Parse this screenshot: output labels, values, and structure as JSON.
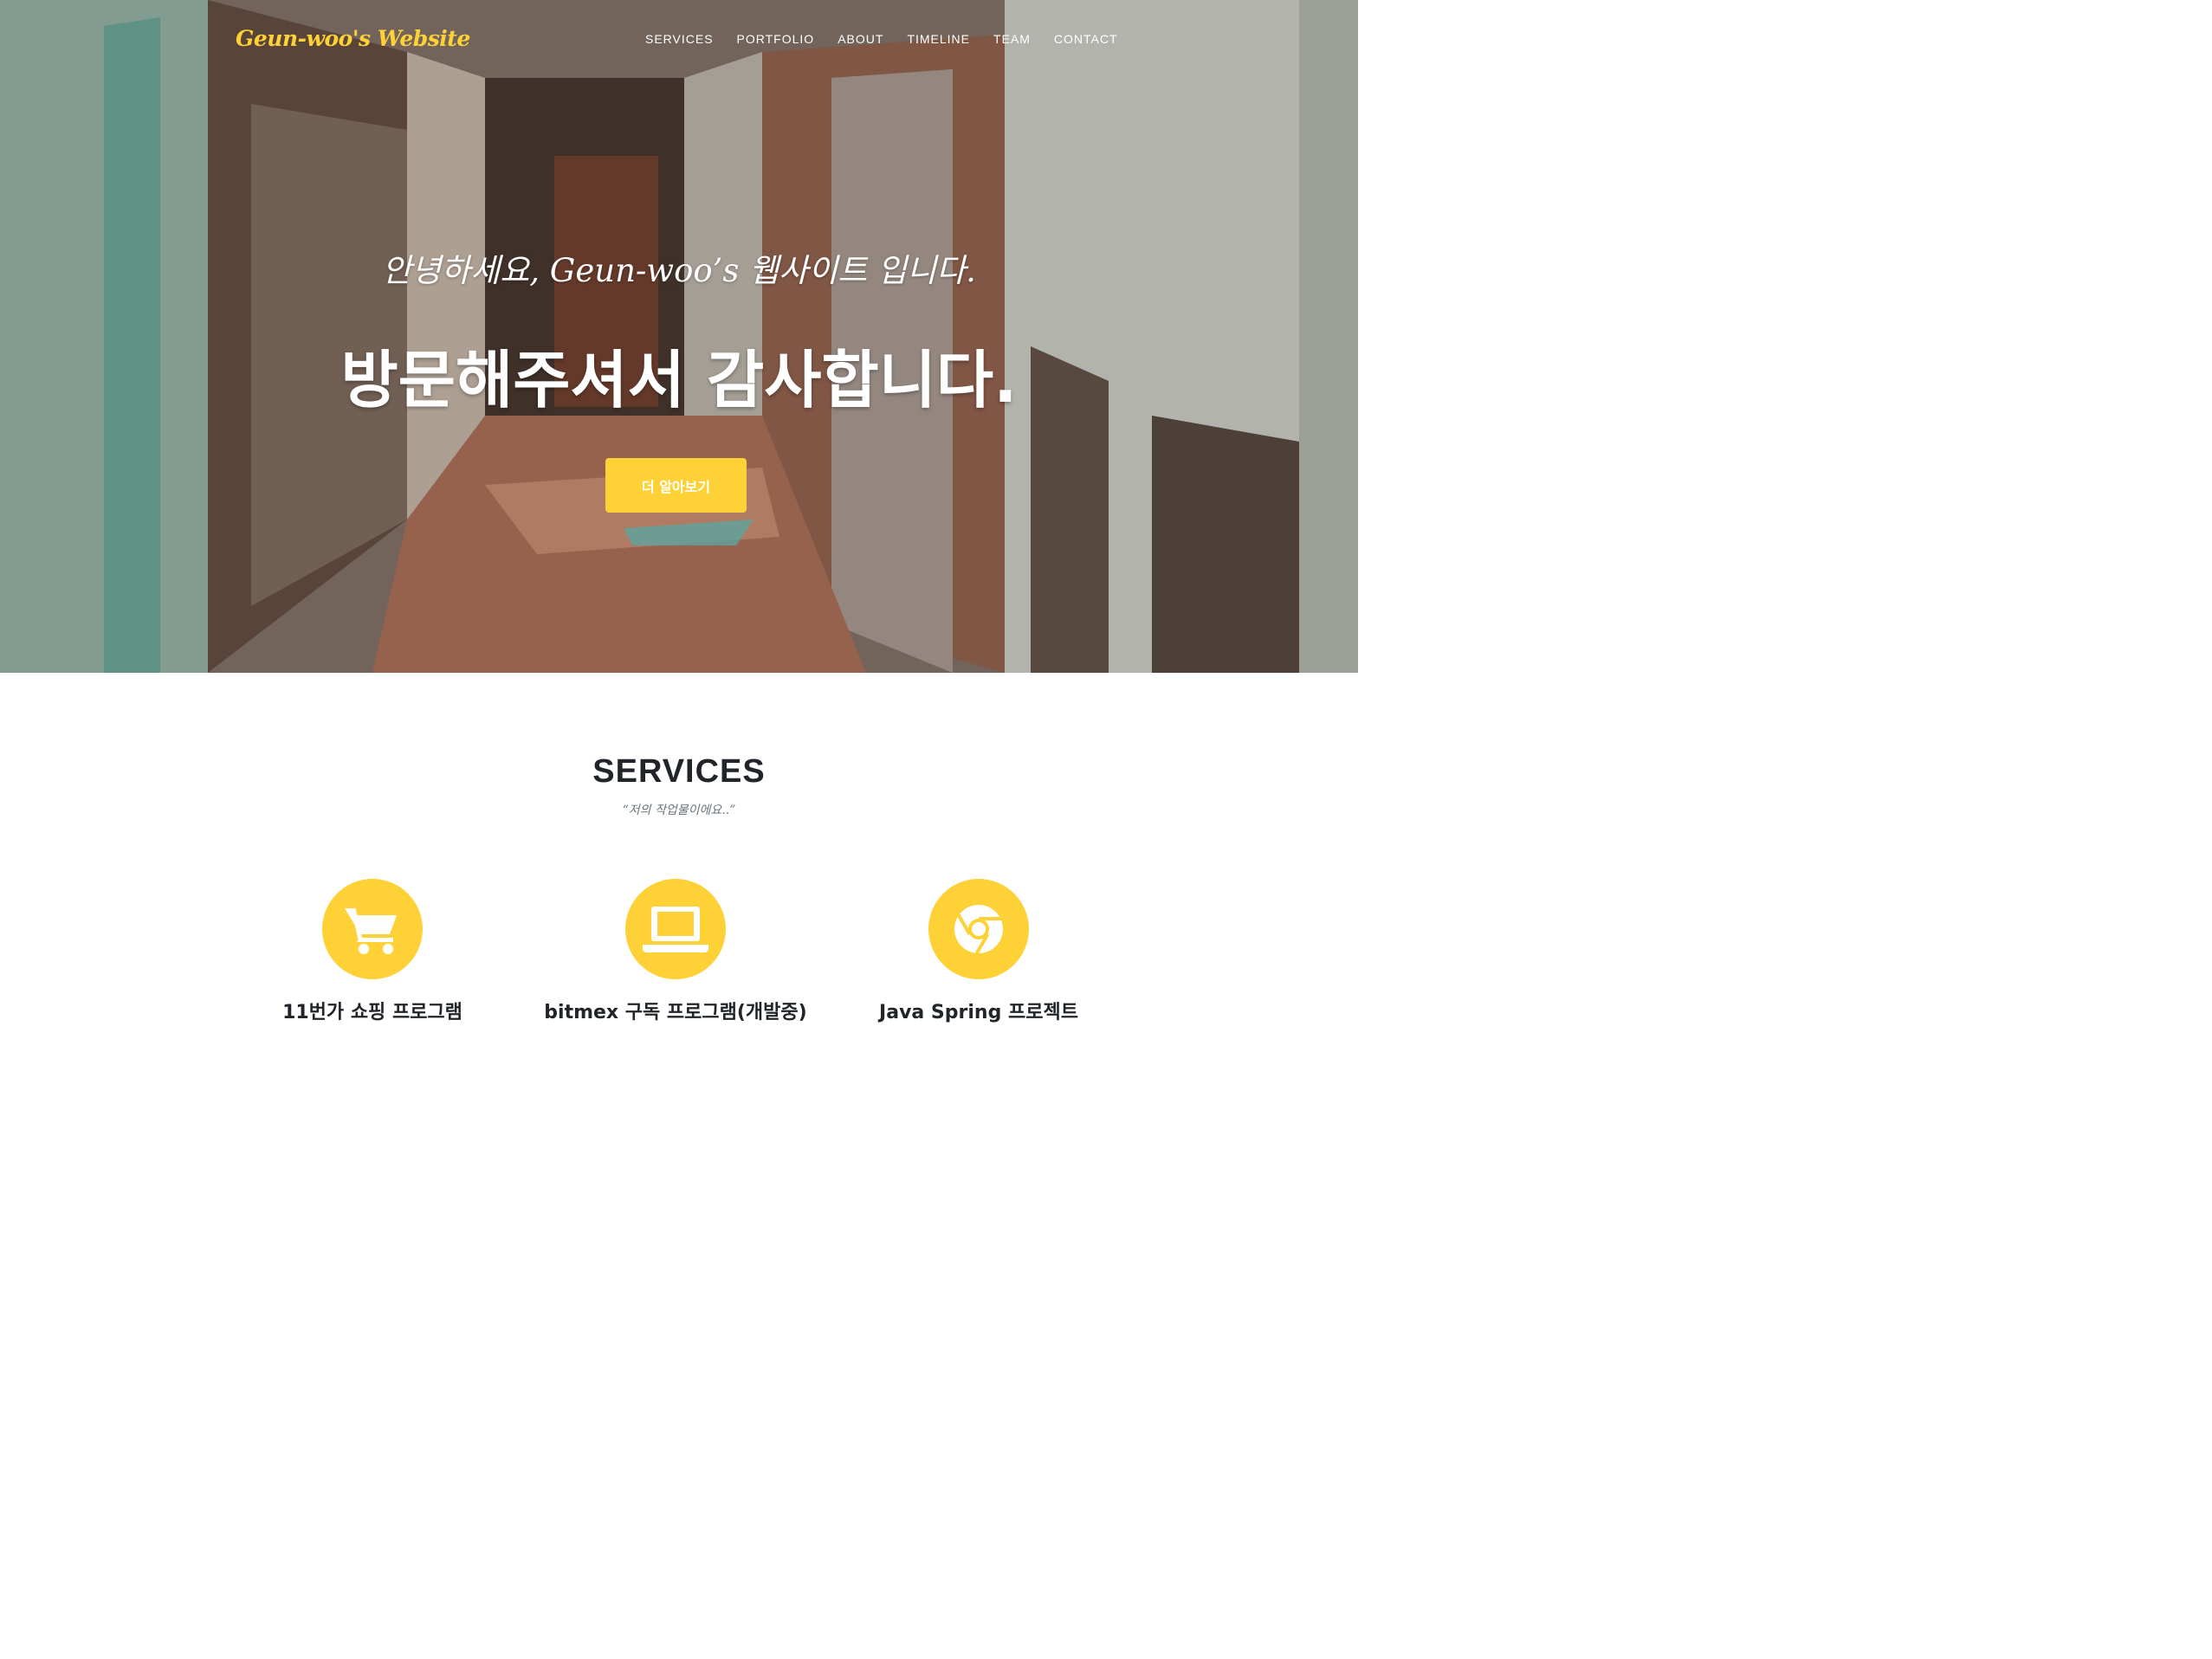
{
  "navbar": {
    "brand": "Geun-woo's Website",
    "items": [
      {
        "label": "SERVICES"
      },
      {
        "label": "PORTFOLIO"
      },
      {
        "label": "ABOUT"
      },
      {
        "label": "TIMELINE"
      },
      {
        "label": "TEAM"
      },
      {
        "label": "CONTACT"
      }
    ]
  },
  "hero": {
    "subheading": "안녕하세요, Geun-woo’s 웹사이트 입니다.",
    "heading": "방문해주셔서 감사합니다.",
    "button_label": "더 알아보기"
  },
  "services": {
    "heading": "SERVICES",
    "subheading": "“저의 작업물이에요..”",
    "items": [
      {
        "icon": "shopping-cart-icon",
        "title": "11번가 쇼핑 프로그램"
      },
      {
        "icon": "laptop-icon",
        "title": "bitmex 구독 프로그램(개발중)"
      },
      {
        "icon": "chrome-icon",
        "title": "Java Spring 프로젝트"
      }
    ]
  },
  "colors": {
    "accent": "#fed136",
    "heading": "#212529",
    "muted": "#6c757d"
  }
}
